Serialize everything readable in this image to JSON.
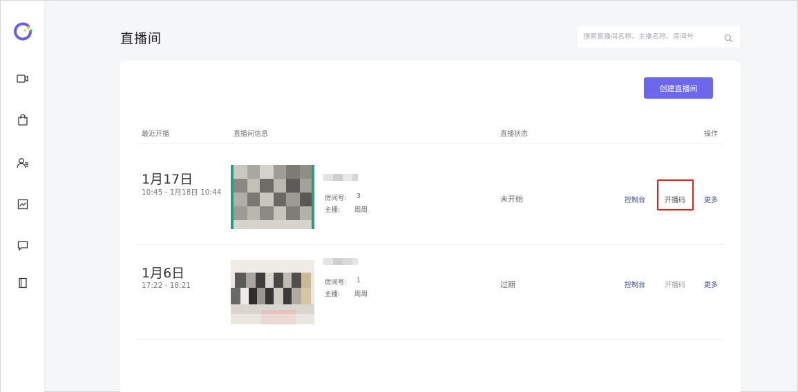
{
  "colors": {
    "accent": "#6d67ee",
    "highlight": "#e0201b",
    "logo_arc": "#6b5cf0",
    "logo_dot_yellow": "#f4c430",
    "logo_dot_green": "#37c98a"
  },
  "sidebar": {
    "items": [
      {
        "icon": "video-camera-icon"
      },
      {
        "icon": "shopping-bag-icon"
      },
      {
        "icon": "user-list-icon"
      },
      {
        "icon": "image-chart-icon"
      },
      {
        "icon": "chat-message-icon"
      },
      {
        "icon": "book-icon"
      }
    ]
  },
  "header": {
    "title": "直播间",
    "search_placeholder": "搜索直播间名称、主播名称、房间号"
  },
  "toolbar": {
    "create_label": "创建直播间"
  },
  "table": {
    "columns": {
      "recent": "最近开播",
      "info": "直播间信息",
      "status": "直播状态",
      "actions": "操作"
    },
    "rows": [
      {
        "date": "1月17日",
        "range": "10:45 - 1月18日 10:44",
        "room_label": "房间号:",
        "room_value": "3",
        "host_label": "主播:",
        "host_value": "周周",
        "status": "未开始",
        "console": "控制台",
        "code": "开播码",
        "more": "更多"
      },
      {
        "date": "1月6日",
        "range": "17:22 - 18:21",
        "room_label": "房间号:",
        "room_value": "1",
        "host_label": "主播:",
        "host_value": "周周",
        "status": "过期",
        "console": "控制台",
        "code": "开播码",
        "more": "更多"
      }
    ]
  }
}
